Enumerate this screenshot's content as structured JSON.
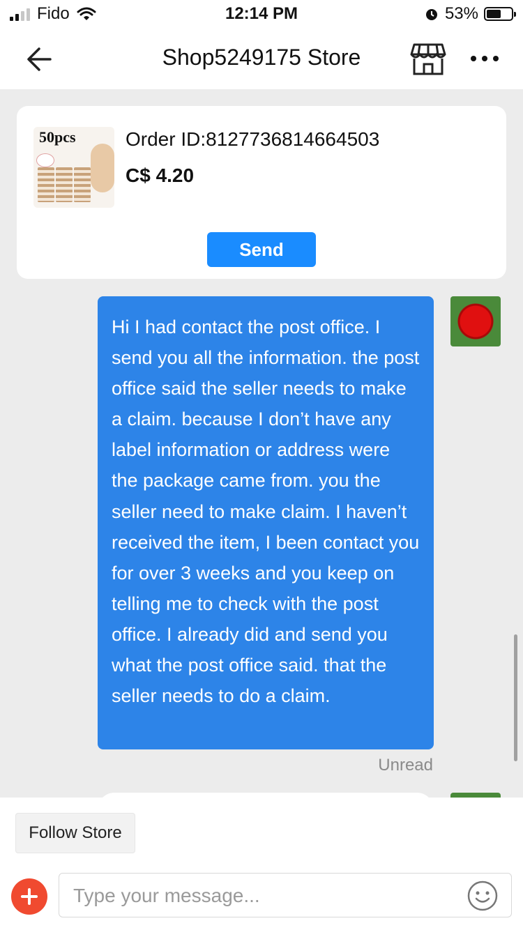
{
  "status_bar": {
    "carrier": "Fido",
    "time": "12:14 PM",
    "battery_percent": "53%",
    "battery_level": 0.53
  },
  "header": {
    "title": "Shop5249175 Store"
  },
  "order_card": {
    "image_label": "50pcs",
    "order_id": "Order ID:8127736814664503",
    "price": "C$ 4.20",
    "send_label": "Send"
  },
  "chat": {
    "messages": [
      {
        "text": "Hi I had contact the post office. I send you all the information. the post office said the seller needs to make a claim. because I don’t have any label information or address were the package came from. you the seller need to make claim. I haven’t received the item, I been contact you for over 3 weeks and you keep on telling me to check with the post office. I already did and send you what the post office said. that the seller needs to do a claim.",
        "status": "Unread"
      }
    ]
  },
  "footer": {
    "follow_label": "Follow Store",
    "message_placeholder": "Type your message..."
  },
  "colors": {
    "accent": "#1a8cff",
    "bubble": "#2d84e8",
    "add_button": "#f04a30"
  }
}
